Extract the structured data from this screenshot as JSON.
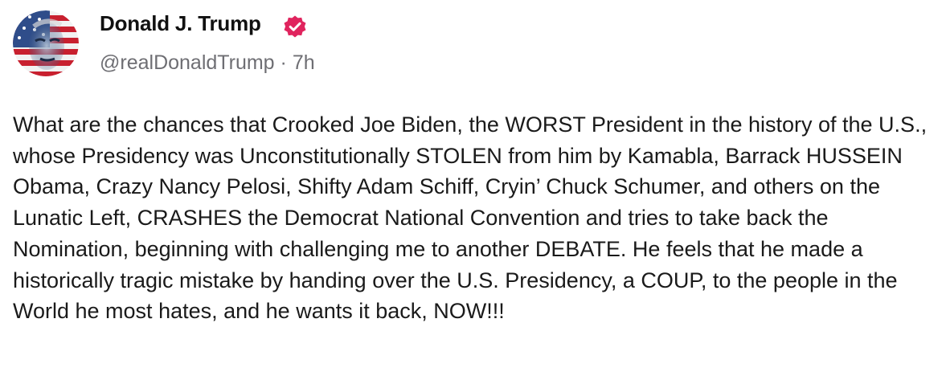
{
  "post": {
    "author": {
      "name": "Donald J. Trump",
      "handle": "@realDonaldTrump",
      "separator": " · ",
      "timestamp": "7h",
      "verified": true,
      "verified_color": "#e0245e",
      "avatar_icon": "flag-portrait-avatar"
    },
    "body": "What are the chances that Crooked Joe Biden, the WORST President in the history of the U.S., whose Presidency was Unconstitutionally STOLEN from him by Kamabla, Barrack HUSSEIN Obama, Crazy Nancy Pelosi, Shifty Adam Schiff, Cryin’ Chuck Schumer, and others on the Lunatic Left, CRASHES the Democrat National Convention and tries to take back the Nomination, beginning with challenging me to another DEBATE. He feels that he made a historically tragic mistake by handing over the U.S. Presidency, a COUP, to the people in the World he most hates, and he wants it back, NOW!!!"
  },
  "colors": {
    "name_text": "#111111",
    "meta_text": "#6e6e73",
    "body_text": "#1a1a1a",
    "background": "#ffffff"
  }
}
